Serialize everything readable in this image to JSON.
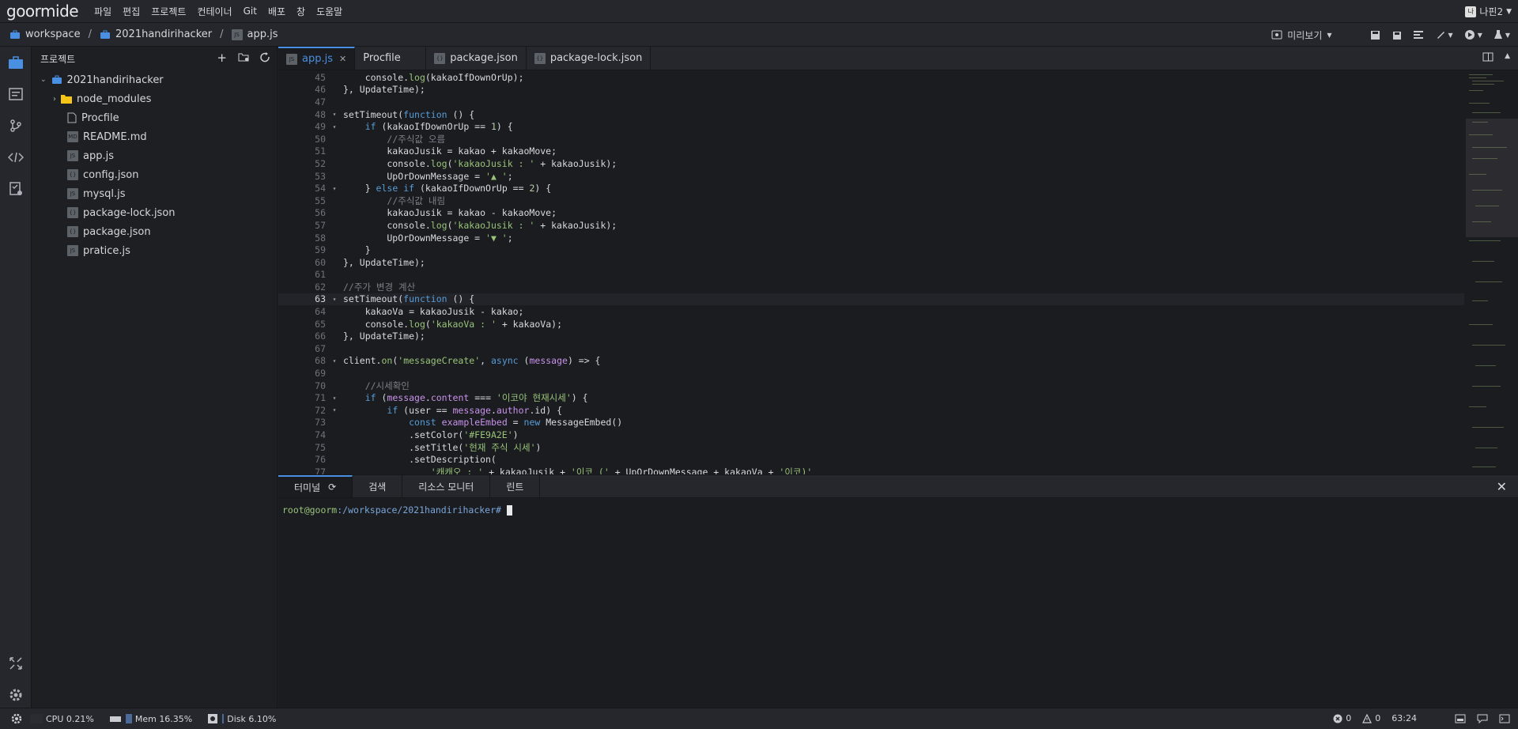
{
  "app": {
    "logo": "goormide"
  },
  "menu": [
    "파일",
    "편집",
    "프로젝트",
    "컨테이너",
    "Git",
    "배포",
    "창",
    "도움말"
  ],
  "user": {
    "avatar": "나",
    "name": "나핀2"
  },
  "breadcrumb": {
    "workspace": "workspace",
    "project": "2021handirihacker",
    "file": "app.js"
  },
  "toolbar": {
    "preview_label": "미리보기"
  },
  "sidebar": {
    "title": "프로젝트",
    "root": "2021handirihacker",
    "items": [
      {
        "name": "node_modules",
        "type": "folder"
      },
      {
        "name": "Procfile",
        "type": "file"
      },
      {
        "name": "README.md",
        "type": "md"
      },
      {
        "name": "app.js",
        "type": "js"
      },
      {
        "name": "config.json",
        "type": "json"
      },
      {
        "name": "mysql.js",
        "type": "js"
      },
      {
        "name": "package-lock.json",
        "type": "json"
      },
      {
        "name": "package.json",
        "type": "json"
      },
      {
        "name": "pratice.js",
        "type": "js"
      }
    ]
  },
  "tabs": [
    {
      "label": "app.js",
      "active": true
    },
    {
      "label": "Procfile"
    },
    {
      "label": "package.json"
    },
    {
      "label": "package-lock.json"
    }
  ],
  "code": [
    {
      "n": "45",
      "t": "    console.log(kakaoIfDownOrUp);"
    },
    {
      "n": "46",
      "t": "}, UpdateTime);"
    },
    {
      "n": "47",
      "t": ""
    },
    {
      "n": "48",
      "t": "setTimeout(function () {",
      "f": true
    },
    {
      "n": "49",
      "t": "    if (kakaoIfDownOrUp == 1) {",
      "f": true
    },
    {
      "n": "50",
      "t": "        //주식값 오름"
    },
    {
      "n": "51",
      "t": "        kakaoJusik = kakao + kakaoMove;"
    },
    {
      "n": "52",
      "t": "        console.log('kakaoJusik : ' + kakaoJusik);"
    },
    {
      "n": "53",
      "t": "        UpOrDownMessage = '▲ ';"
    },
    {
      "n": "54",
      "t": "    } else if (kakaoIfDownOrUp == 2) {",
      "f": true
    },
    {
      "n": "55",
      "t": "        //주식값 내림"
    },
    {
      "n": "56",
      "t": "        kakaoJusik = kakao - kakaoMove;"
    },
    {
      "n": "57",
      "t": "        console.log('kakaoJusik : ' + kakaoJusik);"
    },
    {
      "n": "58",
      "t": "        UpOrDownMessage = '▼ ';"
    },
    {
      "n": "59",
      "t": "    }"
    },
    {
      "n": "60",
      "t": "}, UpdateTime);"
    },
    {
      "n": "61",
      "t": ""
    },
    {
      "n": "62",
      "t": "//주가 변경 계산"
    },
    {
      "n": "63",
      "t": "setTimeout(function () {",
      "f": true,
      "cur": true
    },
    {
      "n": "64",
      "t": "    kakaoVa = kakaoJusik - kakao;"
    },
    {
      "n": "65",
      "t": "    console.log('kakaoVa : ' + kakaoVa);"
    },
    {
      "n": "66",
      "t": "}, UpdateTime);"
    },
    {
      "n": "67",
      "t": ""
    },
    {
      "n": "68",
      "t": "client.on('messageCreate', async (message) => {",
      "f": true
    },
    {
      "n": "69",
      "t": ""
    },
    {
      "n": "70",
      "t": "    //시세확인"
    },
    {
      "n": "71",
      "t": "    if (message.content === '이코야 현재시세') {",
      "f": true
    },
    {
      "n": "72",
      "t": "        if (user == message.author.id) {",
      "f": true
    },
    {
      "n": "73",
      "t": "            const exampleEmbed = new MessageEmbed()"
    },
    {
      "n": "74",
      "t": "            .setColor('#FE9A2E')"
    },
    {
      "n": "75",
      "t": "            .setTitle('현재 주식 시세')"
    },
    {
      "n": "76",
      "t": "            .setDescription("
    },
    {
      "n": "77",
      "t": "                '캐캐오 : ' + kakaoJusik + '이코 (' + UpOrDownMessage + kakaoVa + '이코)'"
    }
  ],
  "panel": {
    "tabs": [
      "터미널",
      "검색",
      "리소스 모니터",
      "린트"
    ],
    "prompt_user": "root@goorm",
    "prompt_path": ":/workspace/2021handirihacker#"
  },
  "status": {
    "cpu_label": "CPU",
    "cpu": "0.21%",
    "mem_label": "Mem",
    "mem": "16.35%",
    "disk_label": "Disk",
    "disk": "6.10%",
    "errors": "0",
    "warnings": "0",
    "position": "63:24"
  },
  "colors": {
    "accent": "#4a90e2",
    "folder": "#f5c518",
    "bg": "#1b1c20"
  }
}
